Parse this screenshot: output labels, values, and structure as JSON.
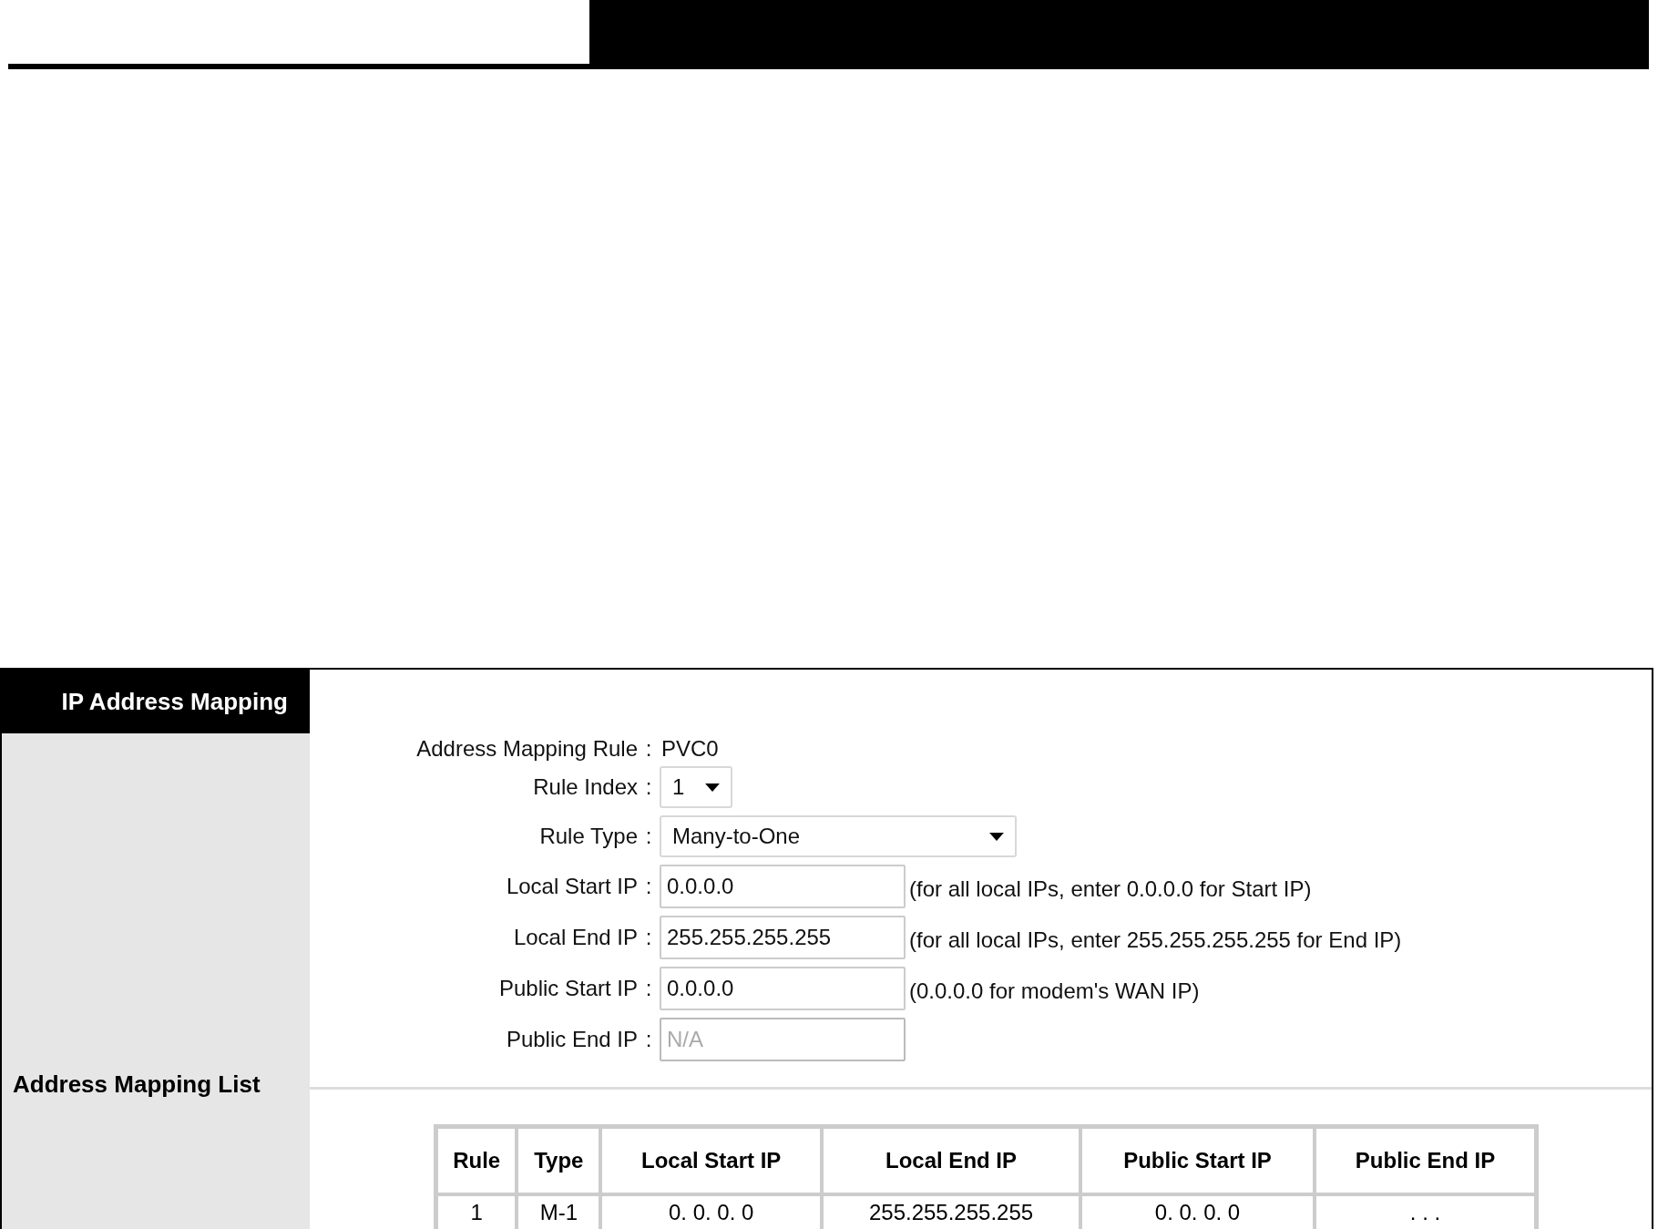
{
  "panel": {
    "title": "IP Address Mapping",
    "list_title": "Address Mapping List"
  },
  "form": {
    "rows": [
      {
        "kind": "text",
        "label": "Address Mapping Rule",
        "colon": ":",
        "value": "PVC0"
      },
      {
        "kind": "select",
        "label": "Rule Index",
        "colon": ":",
        "value": "1"
      },
      {
        "kind": "wide_select",
        "label": "Rule Type",
        "colon": ":",
        "value": "Many-to-One"
      },
      {
        "kind": "input",
        "label": "Local Start IP",
        "colon": ":",
        "value": "0.0.0.0",
        "hint": "(for all local IPs, enter 0.0.0.0 for Start IP)",
        "disabled": false
      },
      {
        "kind": "input",
        "label": "Local End IP",
        "colon": ":",
        "value": "255.255.255.255",
        "hint": "(for all local IPs, enter 255.255.255.255 for End IP)",
        "disabled": false
      },
      {
        "kind": "input",
        "label": "Public Start IP",
        "colon": ":",
        "value": "0.0.0.0",
        "hint": "(0.0.0.0 for modem's WAN IP)",
        "disabled": false
      },
      {
        "kind": "input",
        "label": "Public End IP",
        "colon": ":",
        "placeholder": "N/A",
        "disabled": true
      }
    ]
  },
  "table": {
    "columns": [
      "Rule",
      "Type",
      "Local Start IP",
      "Local End IP",
      "Public Start IP",
      "Public End IP"
    ],
    "rows": [
      [
        "1",
        "M-1",
        "0. 0. 0. 0",
        "255.255.255.255",
        "0. 0. 0. 0",
        ". . ."
      ]
    ]
  }
}
